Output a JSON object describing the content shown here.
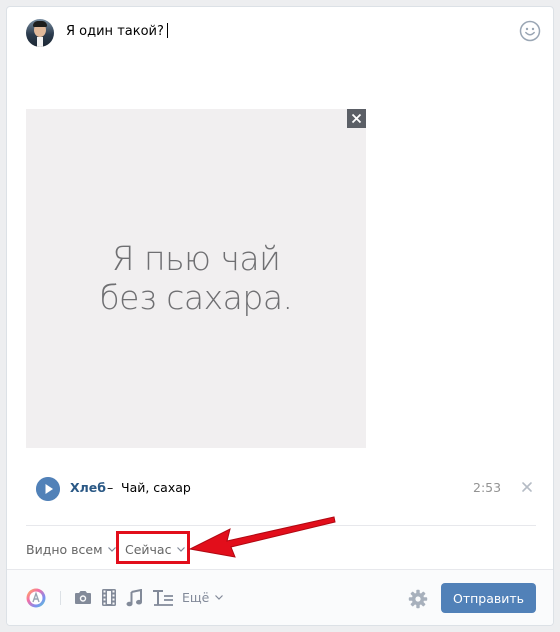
{
  "post": {
    "text": "Я один такой?"
  },
  "image": {
    "line1": "Я пью чай",
    "line2": "без сахара."
  },
  "audio": {
    "artist": "Хлеб",
    "separator": "–",
    "title": "Чай, сахар",
    "duration": "2:53"
  },
  "options": {
    "visibility": "Видно всем",
    "time": "Сейчас"
  },
  "toolbar": {
    "more_label": "Ещё",
    "send_label": "Отправить"
  },
  "colors": {
    "accent": "#5181b8",
    "link": "#2a5885",
    "highlight": "#e20e1b"
  },
  "icons": [
    "avatar",
    "smile-icon",
    "close-icon",
    "play-icon",
    "close-icon",
    "chevron-down-icon",
    "graffiti-icon",
    "camera-icon",
    "video-icon",
    "music-icon",
    "text-format-icon",
    "gear-icon"
  ]
}
